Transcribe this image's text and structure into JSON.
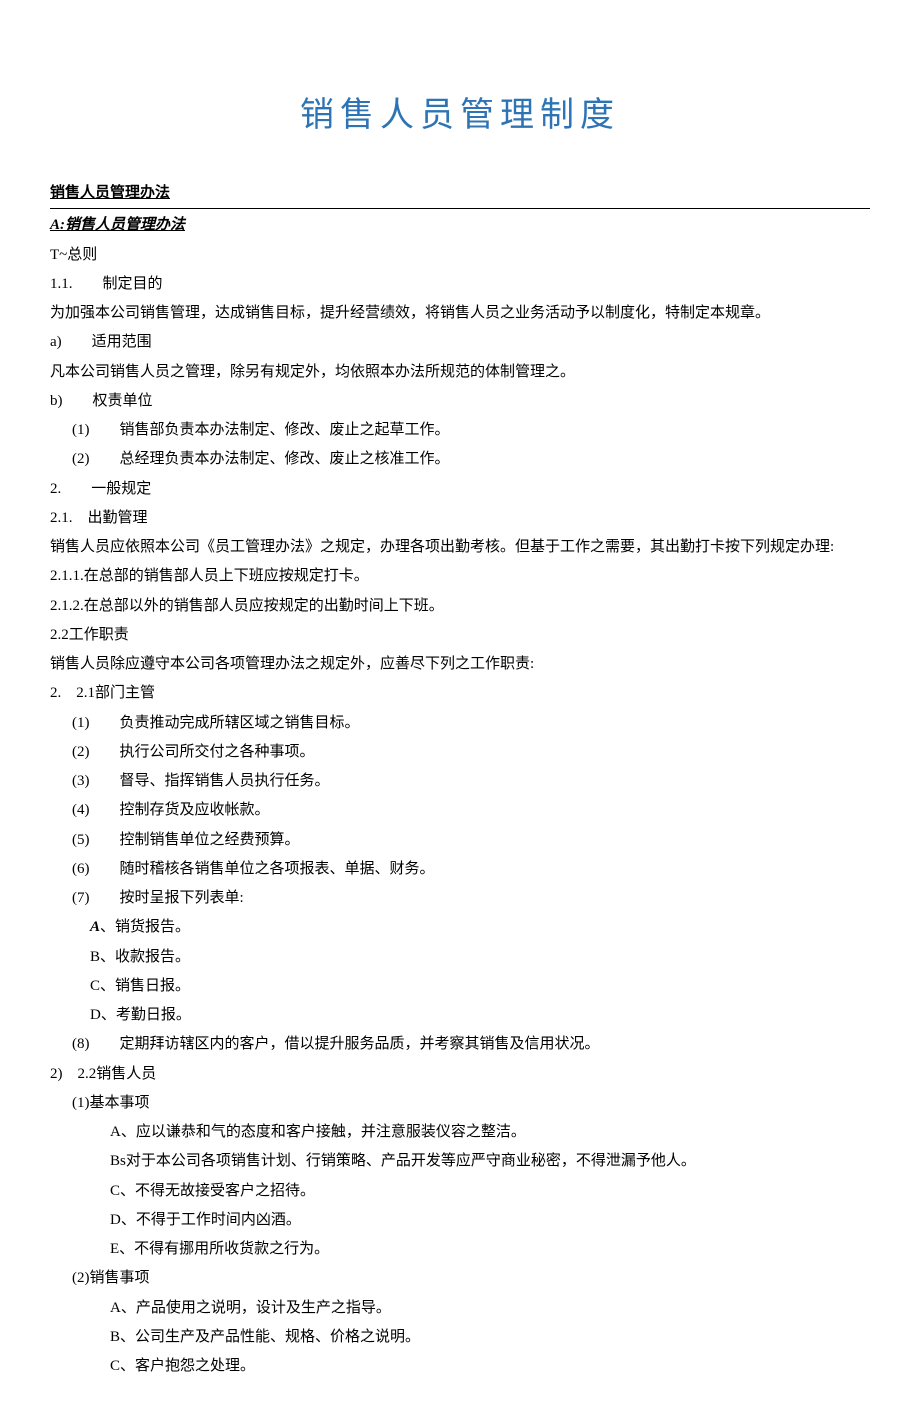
{
  "title": "销售人员管理制度",
  "h1": "销售人员管理办法",
  "h2": "A:销售人员管理办法",
  "s1": "T~总则",
  "s1_1": "1.1.　　制定目的",
  "p1": "为加强本公司销售管理，达成销售目标，提升经营绩效，将销售人员之业务活动予以制度化，特制定本规章。",
  "a": "a)　　适用范围",
  "pa": "凡本公司销售人员之管理，除另有规定外，均依照本办法所规范的体制管理之。",
  "b": "b)　　权责单位",
  "b1": "(1)　　销售部负责本办法制定、修改、废止之起草工作。",
  "b2": "(2)　　总经理负责本办法制定、修改、废止之核准工作。",
  "s2": "2.　　一般规定",
  "s2_1": "2.1.　出勤管理",
  "p2_1": "销售人员应依照本公司《员工管理办法》之规定，办理各项出勤考核。但基于工作之需要，其出勤打卡按下列规定办理:",
  "s2_1_1": "2.1.1.在总部的销售部人员上下班应按规定打卡。",
  "s2_1_2": "2.1.2.在总部以外的销售部人员应按规定的出勤时间上下班。",
  "s2_2": "2.2工作职责",
  "p2_2": "销售人员除应遵守本公司各项管理办法之规定外，应善尽下列之工作职责:",
  "s2_2_1": "2.　2.1部门主管",
  "d1": "(1)　　负责推动完成所辖区域之销售目标。",
  "d2": "(2)　　执行公司所交付之各种事项。",
  "d3": "(3)　　督导、指挥销售人员执行任务。",
  "d4": "(4)　　控制存货及应收帐款。",
  "d5": "(5)　　控制销售单位之经费预算。",
  "d6": "(6)　　随时稽核各销售单位之各项报表、单据、财务。",
  "d7": "(7)　　按时呈报下列表单:",
  "d7a_pre": "A",
  "d7a": "、销货报告。",
  "d7b": "B、收款报告。",
  "d7c": "C、销售日报。",
  "d7d": "D、考勤日报。",
  "d8": "(8)　　定期拜访辖区内的客户，借以提升服务品质，并考察其销售及信用状况。",
  "s2_2_2": "2)　2.2销售人员",
  "e1": "(1)基本事项",
  "e1a": "A、应以谦恭和气的态度和客户接触，并注意服装仪容之整洁。",
  "e1b": "Bs对于本公司各项销售计划、行销策略、产品开发等应严守商业秘密，不得泄漏予他人。",
  "e1c": "C、不得无故接受客户之招待。",
  "e1d": "D、不得于工作时间内凶酒。",
  "e1e": "E、不得有挪用所收货款之行为。",
  "e2": "(2)销售事项",
  "e2a": "A、产品使用之说明，设计及生产之指导。",
  "e2b": "B、公司生产及产品性能、规格、价格之说明。",
  "e2c": "C、客户抱怨之处理。"
}
